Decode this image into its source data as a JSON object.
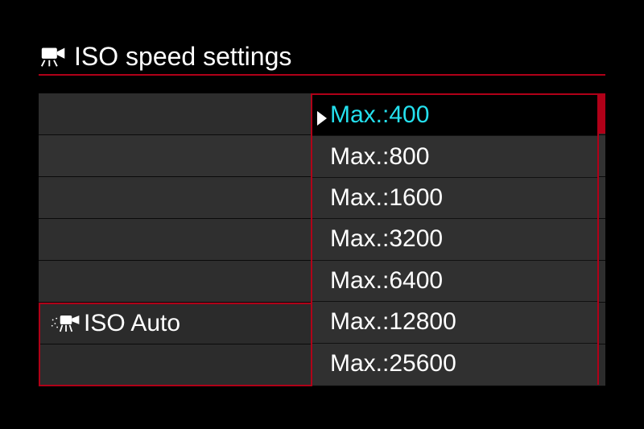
{
  "header": {
    "title": "ISO speed settings"
  },
  "current_item": {
    "label": "ISO Auto"
  },
  "popup": {
    "selected_index": 0,
    "options": [
      "Max.:400",
      "Max.:800",
      "Max.:1600",
      "Max.:3200",
      "Max.:6400",
      "Max.:12800",
      "Max.:25600"
    ]
  },
  "colors": {
    "accent": "#b00018",
    "highlight": "#24e0ee"
  }
}
